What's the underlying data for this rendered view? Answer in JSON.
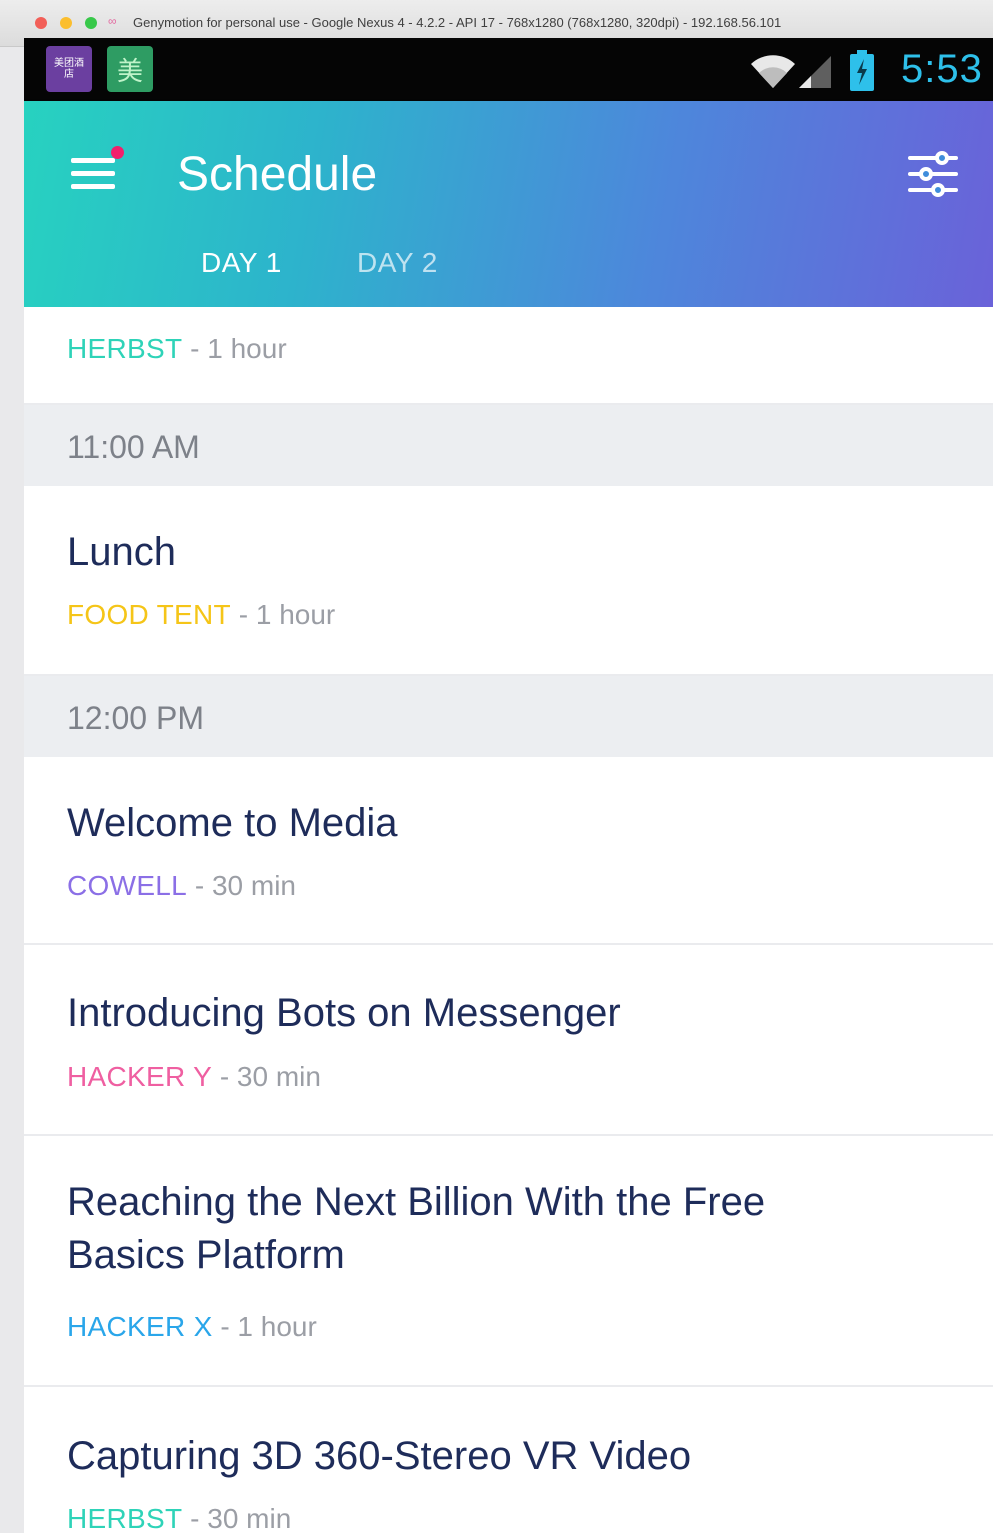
{
  "window": {
    "title": "Genymotion for personal use - Google Nexus 4 - 4.2.2 - API 17 - 768x1280 (768x1280, 320dpi) - 192.168.56.101"
  },
  "statusbar": {
    "time": "5:53",
    "app_icon_1": "美团酒店",
    "app_icon_2": "美"
  },
  "toolbar": {
    "title": "Schedule",
    "tabs": [
      {
        "label": "DAY 1",
        "selected": true
      },
      {
        "label": "DAY 2",
        "selected": false
      }
    ],
    "icons": {
      "menu": "menu-icon",
      "notification_dot_color": "#f0206c",
      "filter": "filter-icon"
    }
  },
  "schedule": {
    "partial_item": {
      "room": "HERBST",
      "duration": "- 1 hour",
      "room_color": "#2ed3b8"
    },
    "sections": [
      {
        "time": "11:00 AM",
        "items": [
          {
            "title": "Lunch",
            "room": "FOOD TENT",
            "duration": "- 1 hour",
            "room_color": "#f5c518"
          }
        ]
      },
      {
        "time": "12:00 PM",
        "items": [
          {
            "title": "Welcome to Media",
            "room": "COWELL",
            "duration": "- 30 min",
            "room_color": "#8b6fe6"
          },
          {
            "title": "Introducing Bots on Messenger",
            "room": "HACKER Y",
            "duration": "- 30 min",
            "room_color": "#ef5fa1"
          },
          {
            "title": "Reaching the Next Billion With the Free Basics Platform",
            "room": "HACKER X",
            "duration": "- 1 hour",
            "room_color": "#2aa6ea"
          },
          {
            "title": "Capturing 3D 360-Stereo VR Video",
            "room": "HERBST",
            "duration": "- 30 min",
            "room_color": "#2ed3b8"
          }
        ]
      }
    ]
  }
}
